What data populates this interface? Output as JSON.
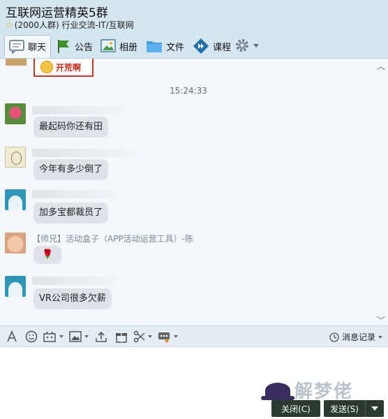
{
  "window": {
    "title": "互联网运营精英5群",
    "member_count": "(2000人群)",
    "category": "行业交流-IT/互联网"
  },
  "tabs": [
    {
      "label": "聊天",
      "icon": "chat-bubble-icon",
      "active": true
    },
    {
      "label": "公告",
      "icon": "flag-icon"
    },
    {
      "label": "相册",
      "icon": "photo-icon"
    },
    {
      "label": "文件",
      "icon": "folder-icon"
    },
    {
      "label": "课程",
      "icon": "course-icon"
    }
  ],
  "chat": {
    "sticker_text": "开荒啊",
    "timestamp": "15:24:33",
    "messages": [
      {
        "sender": "",
        "avatar": "rose-avatar",
        "text": "最起码你还有田"
      },
      {
        "sender": "",
        "avatar": "sketch-avatar",
        "text": "今年有多少倒了"
      },
      {
        "sender": "",
        "avatar": "teal-avatar",
        "text": "加多宝都裁员了"
      },
      {
        "sender": "【师兄】活动盒子（APP活动运营工具）-陈",
        "avatar": "baby-avatar",
        "text": "🌹"
      },
      {
        "sender": "",
        "avatar": "teal-avatar",
        "text": "VR公司很多欠薪"
      }
    ]
  },
  "composer": {
    "history_label": "消息记录"
  },
  "buttons": {
    "close_label": "关闭(C)",
    "send_label": "发送(S)"
  },
  "watermark": {
    "text": "解梦佬"
  }
}
